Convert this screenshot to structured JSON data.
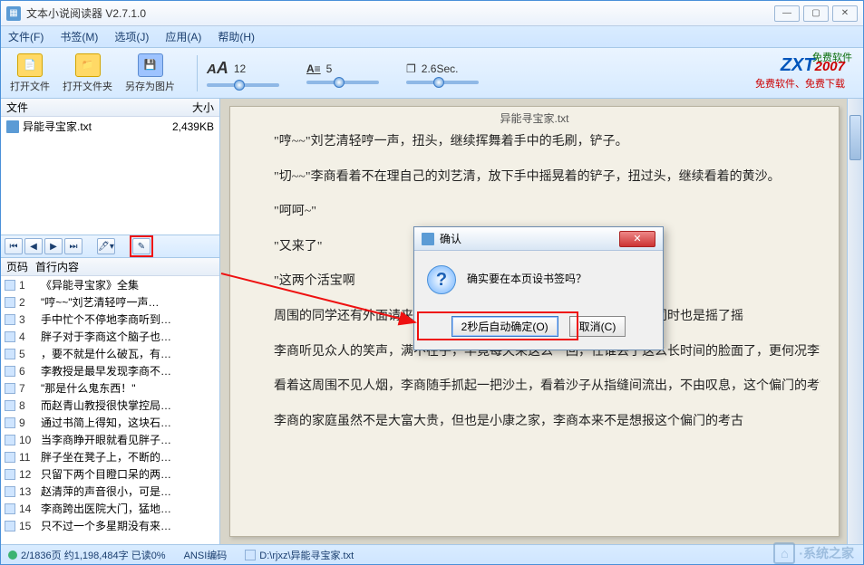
{
  "window": {
    "title": "文本小说阅读器 V2.7.1.0"
  },
  "menu": {
    "file": "文件(F)",
    "bookmark": "书签(M)",
    "options": "选项(J)",
    "apps": "应用(A)",
    "help": "帮助(H)"
  },
  "toolbar": {
    "open_file": "打开文件",
    "open_folder": "打开文件夹",
    "save_as_pic": "另存为图片",
    "font_size": "12",
    "line_spacing": "5",
    "interval": "2.6Sec.",
    "free_text": "免费软件",
    "brand": "ZXT",
    "brand_year": "2007",
    "brand_sub": "免费软件、免费下载"
  },
  "file_panel": {
    "hdr_name": "文件",
    "hdr_size": "大小",
    "rows": [
      {
        "name": "异能寻宝家.txt",
        "size": "2,439KB"
      }
    ]
  },
  "page_panel": {
    "hdr_page": "页码",
    "hdr_first": "首行内容",
    "rows": [
      {
        "n": "1",
        "t": "《异能寻宝家》全集"
      },
      {
        "n": "2",
        "t": "\"哼~~\"刘艺清轻哼一声…"
      },
      {
        "n": "3",
        "t": "手中忙个不停地李商听到…"
      },
      {
        "n": "4",
        "t": "胖子对于李商这个脑子也…"
      },
      {
        "n": "5",
        "t": "，要不就是什么破瓦，有…"
      },
      {
        "n": "6",
        "t": "李教授是最早发现李商不…"
      },
      {
        "n": "7",
        "t": "\"那是什么鬼东西！\""
      },
      {
        "n": "8",
        "t": "而赵青山教授很快掌控局…"
      },
      {
        "n": "9",
        "t": "通过书简上得知，这块石…"
      },
      {
        "n": "10",
        "t": "当李商睁开眼就看见胖子…"
      },
      {
        "n": "11",
        "t": "胖子坐在凳子上，不断的…"
      },
      {
        "n": "12",
        "t": "只留下两个目瞪口呆的两…"
      },
      {
        "n": "13",
        "t": "赵清萍的声音很小，可是…"
      },
      {
        "n": "14",
        "t": "李商跨出医院大门，猛地…"
      },
      {
        "n": "15",
        "t": "只不过一个多星期没有来…"
      }
    ]
  },
  "reader": {
    "filename": "异能寻宝家.txt",
    "paragraphs": [
      "\"哼~~\"刘艺清轻哼一声，扭头，继续挥舞着手中的毛刷，铲子。",
      "\"切~~\"李商看着不在理自己的刘艺清，放下手中摇晃着的铲子，扭过头，继续看着的黄沙。",
      "\"呵呵~\"",
      "\"又来了\"",
      "\"这两个活宝啊",
      "周围的同学还有外面请来考古发掘的人看见这一对活宝，不由笑了，同时也是摇了摇",
      "李商听见众人的笑声，满不在乎，毕竟每天来这么一回，任谁丢了这么长时间的脸面了，更何况李商这个在考古系号称最厚脸皮的人呢！",
      "看着这周围不见人烟，李商随手抓起一把沙土，看着沙子从指缝间流出，不由叹息，这个偏门的考古系，毕业之后能干什么呀！",
      "李商的家庭虽然不是大富大贵，但也是小康之家，李商本来不是想报这个偏门的考古"
    ]
  },
  "dialog": {
    "title": "确认",
    "message": "确实要在本页设书签吗？",
    "ok": "2秒后自动确定(O)",
    "cancel": "取消(C)"
  },
  "status": {
    "pages": "2/1836页 约1,198,484字 已读0%",
    "encoding": "ANSI编码",
    "path": "D:\\rjxz\\异能寻宝家.txt",
    "watermark": "·系统之家"
  }
}
